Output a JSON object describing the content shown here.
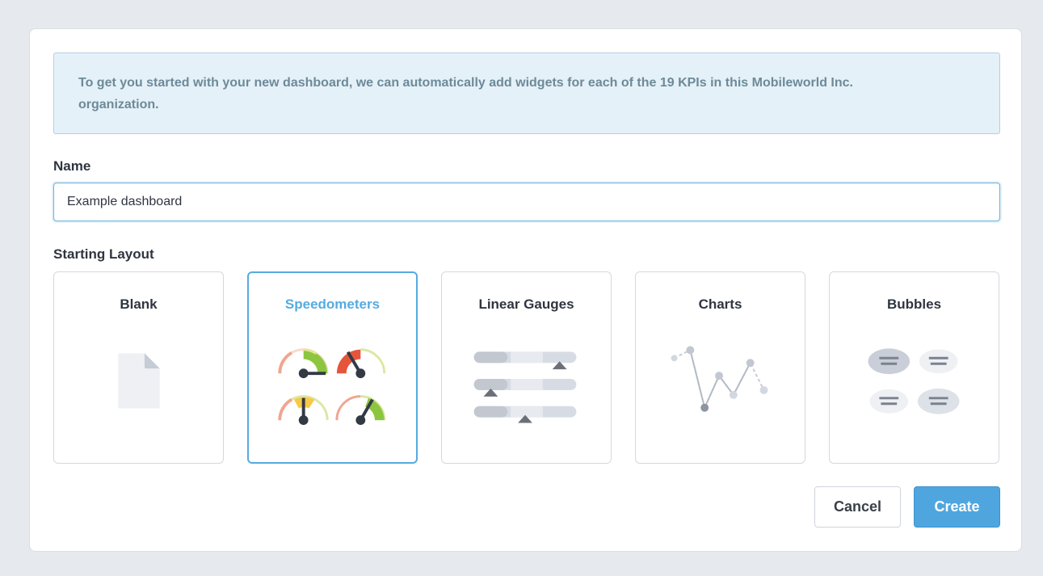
{
  "notice": {
    "line1": "To get you started with your new dashboard, we can automatically add widgets for each of the 19 KPIs in this Mobileworld Inc.",
    "line2": "organization."
  },
  "form": {
    "name_label": "Name",
    "name_value": "Example dashboard",
    "layout_label": "Starting Layout"
  },
  "layouts": [
    {
      "label": "Blank",
      "icon": "blank-page-icon",
      "selected": false
    },
    {
      "label": "Speedometers",
      "icon": "speedometers-icon",
      "selected": true
    },
    {
      "label": "Linear Gauges",
      "icon": "linear-gauges-icon",
      "selected": false
    },
    {
      "label": "Charts",
      "icon": "line-chart-icon",
      "selected": false
    },
    {
      "label": "Bubbles",
      "icon": "bubbles-icon",
      "selected": false
    }
  ],
  "buttons": {
    "cancel": "Cancel",
    "create": "Create"
  },
  "colors": {
    "accent": "#55abe0",
    "primary_button": "#4fa6df",
    "notice_bg": "#e5f1f8",
    "notice_text": "#6d8a99",
    "gauge_green": "#8cc63f",
    "gauge_red": "#e5553b",
    "gauge_yellow": "#f7c948"
  }
}
